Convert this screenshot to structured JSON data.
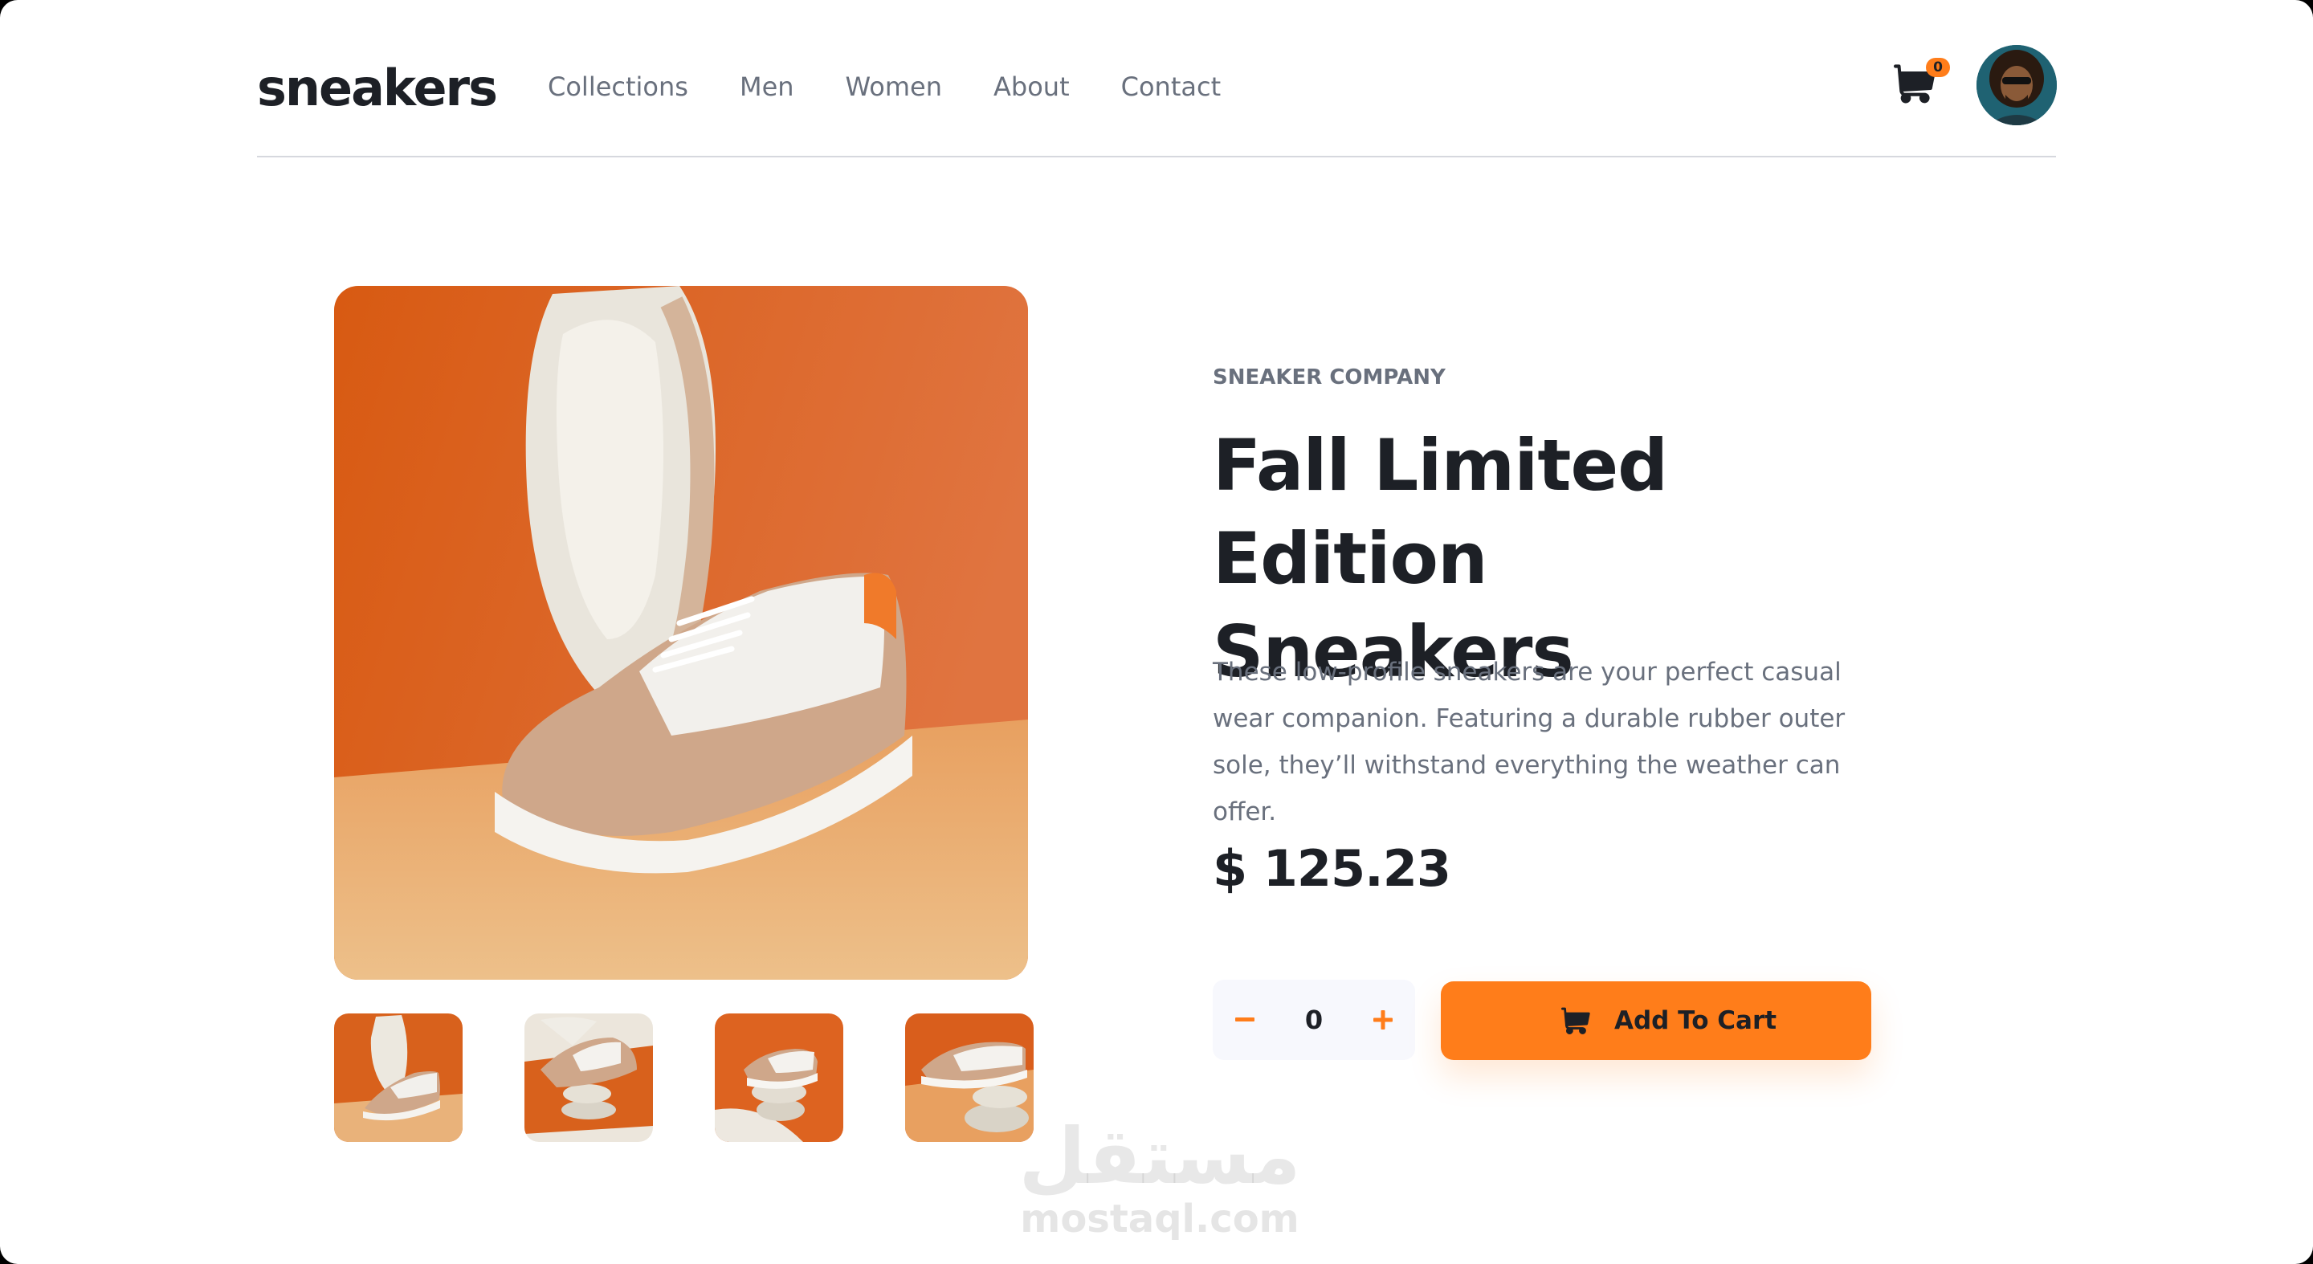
{
  "header": {
    "logo": "sneakers",
    "nav": [
      "Collections",
      "Men",
      "Women",
      "About",
      "Contact"
    ],
    "cart_count": "0",
    "cart_icon": "cart-icon",
    "avatar": "user-avatar"
  },
  "product": {
    "company": "SNEAKER COMPANY",
    "title_line1": "Fall Limited Edition",
    "title_line2": "Sneakers",
    "description": "These low-profile sneakers are your perfect casual wear companion. Featuring a durable rubber outer sole, they’ll withstand everything the weather can offer.",
    "price": "$ 125.23"
  },
  "gallery": {
    "main_image": "product-image-1",
    "thumbnails": [
      "product-image-1",
      "product-image-2",
      "product-image-3",
      "product-image-4"
    ]
  },
  "quantity": {
    "value": "0",
    "minus_icon": "minus-icon",
    "plus_icon": "plus-icon"
  },
  "add_to_cart": {
    "label": "Add To Cart",
    "icon": "cart-icon"
  },
  "watermark": {
    "arabic": "مستقل",
    "text": "mostaql.com"
  },
  "colors": {
    "accent": "#ff7d1a",
    "dark": "#1d2026",
    "muted": "#69707d",
    "light_bg": "#f7f8fd",
    "divider": "#d6d8de"
  }
}
